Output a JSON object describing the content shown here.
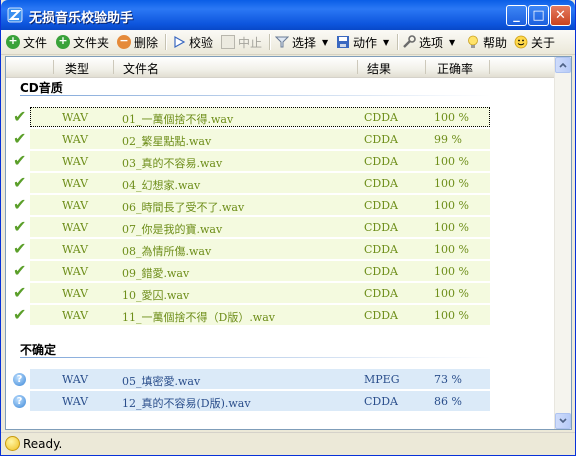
{
  "window": {
    "title": "无损音乐校验助手"
  },
  "toolbar": {
    "file": "文件",
    "folder": "文件夹",
    "delete": "删除",
    "verify": "校验",
    "stop": "中止",
    "select": "选择",
    "action": "动作",
    "options": "选项",
    "help": "帮助",
    "about": "关于"
  },
  "columns": {
    "type": "类型",
    "filename": "文件名",
    "result": "结果",
    "accuracy": "正确率"
  },
  "groups": [
    {
      "title": "CD音质",
      "rows": [
        {
          "type": "WAV",
          "filename": "01_一萬個捨不得.wav",
          "result": "CDDA",
          "accuracy": "100 %"
        },
        {
          "type": "WAV",
          "filename": "02_繁星點點.wav",
          "result": "CDDA",
          "accuracy": "99 %"
        },
        {
          "type": "WAV",
          "filename": "03_真的不容易.wav",
          "result": "CDDA",
          "accuracy": "100 %"
        },
        {
          "type": "WAV",
          "filename": "04_幻想家.wav",
          "result": "CDDA",
          "accuracy": "100 %"
        },
        {
          "type": "WAV",
          "filename": "06_時間長了受不了.wav",
          "result": "CDDA",
          "accuracy": "100 %"
        },
        {
          "type": "WAV",
          "filename": "07_你是我的寶.wav",
          "result": "CDDA",
          "accuracy": "100 %"
        },
        {
          "type": "WAV",
          "filename": "08_為情所傷.wav",
          "result": "CDDA",
          "accuracy": "100 %"
        },
        {
          "type": "WAV",
          "filename": "09_錯愛.wav",
          "result": "CDDA",
          "accuracy": "100 %"
        },
        {
          "type": "WAV",
          "filename": "10_愛囚.wav",
          "result": "CDDA",
          "accuracy": "100 %"
        },
        {
          "type": "WAV",
          "filename": "11_一萬個捨不得（D版）.wav",
          "result": "CDDA",
          "accuracy": "100 %"
        }
      ]
    },
    {
      "title": "不确定",
      "rows": [
        {
          "type": "WAV",
          "filename": "05_填密愛.wav",
          "result": "MPEG",
          "accuracy": "73 %"
        },
        {
          "type": "WAV",
          "filename": "12_真的不容易(D版).wav",
          "result": "CDDA",
          "accuracy": "86 %"
        }
      ]
    }
  ],
  "status": {
    "text": "Ready."
  }
}
